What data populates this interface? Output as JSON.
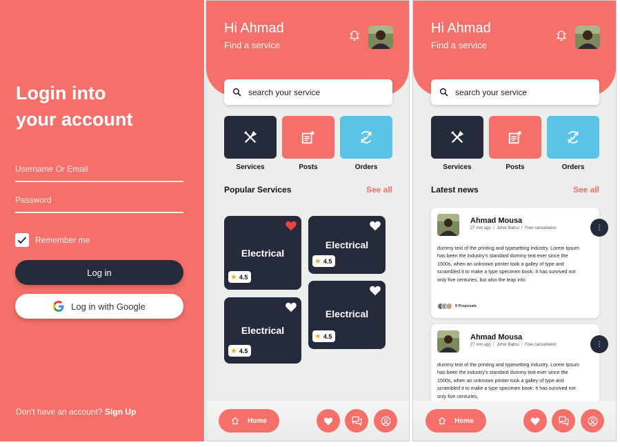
{
  "colors": {
    "brand": "#F5706A",
    "dark": "#262B3B",
    "blue": "#5BC3E8",
    "bg": "#ECEEEC"
  },
  "login": {
    "title_line1": "Login into",
    "title_line2": "your account",
    "username_placeholder": "Username Or Email",
    "password_placeholder": "Password",
    "remember_label": "Remember me",
    "remember_checked": true,
    "login_button": "Log in",
    "google_button": "Log in with Google",
    "signup_prompt": "Don't have an account?",
    "signup_link": "Sign Up"
  },
  "home": {
    "greeting": "Hi Ahmad",
    "subtitle": "Find a service",
    "search_placeholder": "search your service",
    "tiles": [
      {
        "label": "Services",
        "icon": "tools-icon"
      },
      {
        "label": "Posts",
        "icon": "add-post-icon"
      },
      {
        "label": "Orders",
        "icon": "refresh-check-icon"
      }
    ],
    "popular_title": "Popular Services",
    "see_all": "See all",
    "cards": [
      {
        "title": "Electrical",
        "rating": "4.5",
        "favorited": true
      },
      {
        "title": "Electrical",
        "rating": "4.5",
        "favorited": false
      },
      {
        "title": "Electrical",
        "rating": "4.5",
        "favorited": false
      },
      {
        "title": "Electrical",
        "rating": "4.5",
        "favorited": false
      }
    ],
    "nav": {
      "home_label": "Home"
    }
  },
  "news": {
    "title": "Latest news",
    "see_all": "See all",
    "items": [
      {
        "name": "Ahmad Mousa",
        "time": "27 min ago",
        "location": "Johor Bahru",
        "policy": "Free cancellation",
        "body": "dummy text of the printing and typesetting industry. Lorem Ipsum has been the industry's standard dummy text ever since the 1500s, when an unknown printer took a galley of type and scrambled it to make a type specimen book. It has survived not only five centuries, but also the leap into",
        "proposals": "9 Proposals"
      },
      {
        "name": "Ahmad Mousa",
        "time": "27 min ago",
        "location": "Johor Bahru",
        "policy": "Free cancellation",
        "body": "dummy text of the printing and typesetting industry. Lorem Ipsum has been the industry's standard dummy text ever since the 1500s, when an unknown printer took a galley of type and scrambled it to make a type specimen book. It has survived not only five centuries,"
      }
    ]
  }
}
